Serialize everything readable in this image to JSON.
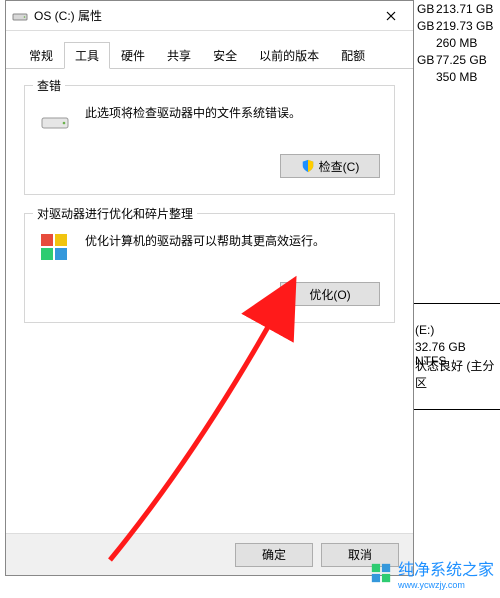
{
  "behind_values": {
    "gb1": "GB",
    "v1": "213.71 GB",
    "gb2": "GB",
    "v2": "219.73 GB",
    "v3": "260 MB",
    "gb4": "GB",
    "v4": "77.25 GB",
    "v5": "350 MB",
    "e_label": "(E:)",
    "e_size": "32.76 GB NTFS",
    "e_status": "状态良好 (主分区"
  },
  "dialog": {
    "title": "OS (C:) 属性",
    "tabs": [
      "常规",
      "工具",
      "硬件",
      "共享",
      "安全",
      "以前的版本",
      "配额"
    ],
    "active_tab": 1,
    "group_check": {
      "title": "查错",
      "desc": "此选项将检查驱动器中的文件系统错误。",
      "button": "检查(C)"
    },
    "group_defrag": {
      "title": "对驱动器进行优化和碎片整理",
      "desc": "优化计算机的驱动器可以帮助其更高效运行。",
      "button": "优化(O)"
    },
    "footer": {
      "ok": "确定",
      "cancel": "取消"
    }
  },
  "watermark": "纯净系统之家",
  "watermark_url": "www.ycwzjy.com"
}
